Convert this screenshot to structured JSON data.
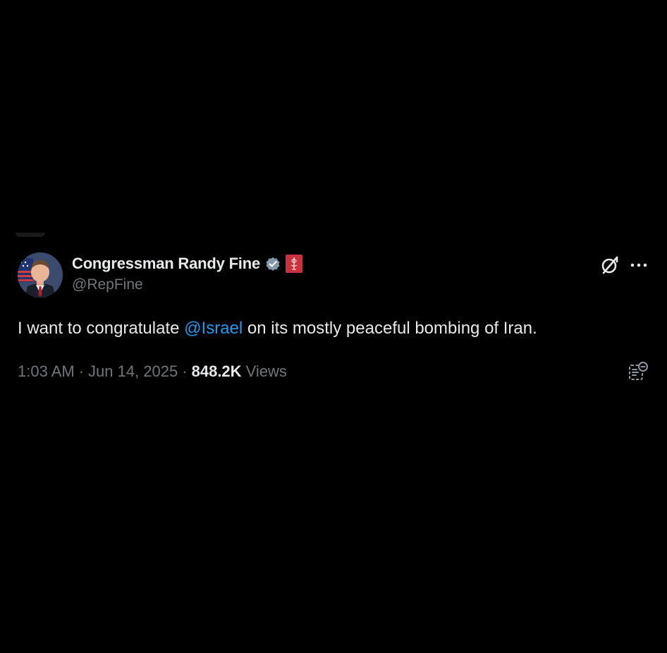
{
  "tweet": {
    "author": {
      "display_name": "Congressman Randy Fine",
      "handle": "@RepFine",
      "verified_icon": "verified-badge-icon",
      "affiliation_icon": "us-house-seal-icon"
    },
    "text": {
      "before_mention": "I want to congratulate ",
      "mention": "@Israel",
      "after_mention": " on its mostly peaceful bombing of Iran."
    },
    "meta": {
      "time": "1:03 AM",
      "separator": "·",
      "date": "Jun 14, 2025",
      "views_count": "848.2K",
      "views_label": "Views"
    },
    "actions": {
      "grok_icon": "grok-icon",
      "more_icon": "more-options-icon",
      "notes_icon": "community-notes-icon"
    }
  },
  "colors": {
    "background": "#000000",
    "primary_text": "#e7e9ea",
    "secondary_text": "#71767b",
    "link": "#1d9bf0",
    "verified": "#829aab",
    "affiliation": "#c8313e"
  }
}
